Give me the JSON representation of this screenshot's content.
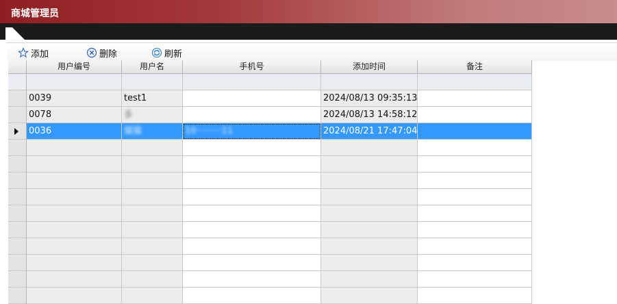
{
  "window": {
    "title": "商城管理员"
  },
  "toolbar": {
    "add_label": "添加",
    "delete_label": "删除",
    "refresh_label": "刷新"
  },
  "grid": {
    "columns": [
      "用户编号",
      "用户名",
      "手机号",
      "添加时间",
      "备注"
    ],
    "rows": [
      {
        "id": "0039",
        "username": "test1",
        "phone": "",
        "added": "2024/08/13 09:35:13",
        "note": ""
      },
      {
        "id": "0078",
        "username": "彡",
        "phone": "",
        "added": "2024/08/13 14:58:12",
        "note": ""
      },
      {
        "id": "0036",
        "username": "猫猫",
        "phone": "10·········11",
        "added": "2024/08/21 17:47:04",
        "note": "",
        "selected": true
      }
    ],
    "empty_rows": 10
  },
  "colors": {
    "title_bar": "#8e1f22",
    "selection": "#3399ff"
  }
}
